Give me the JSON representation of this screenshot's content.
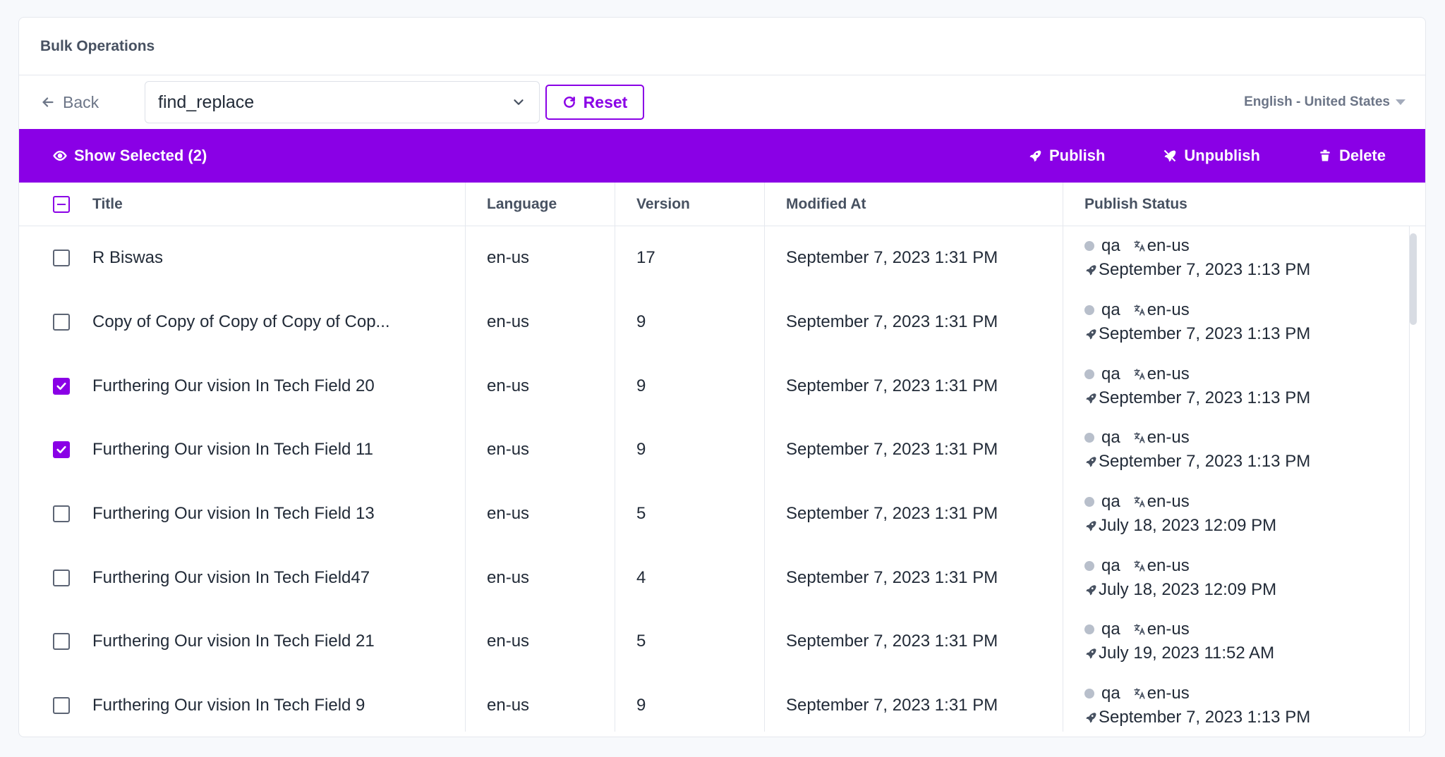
{
  "header": {
    "title": "Bulk Operations"
  },
  "toolbar": {
    "back_label": "Back",
    "select_value": "find_replace",
    "reset_label": "Reset",
    "locale_label": "English - United States"
  },
  "action_bar": {
    "show_selected_label": "Show Selected (2)",
    "publish_label": "Publish",
    "unpublish_label": "Unpublish",
    "delete_label": "Delete"
  },
  "table": {
    "columns": {
      "title": "Title",
      "language": "Language",
      "version": "Version",
      "modified_at": "Modified At",
      "publish_status": "Publish Status"
    },
    "rows": [
      {
        "title": "R Biswas",
        "language": "en-us",
        "version": "17",
        "modified": "September 7, 2023 1:31 PM",
        "env": "qa",
        "pub_lang": "en-us",
        "pub_date": "September 7, 2023 1:13 PM",
        "checked": false
      },
      {
        "title": "Copy of Copy of Copy of Copy of Cop...",
        "language": "en-us",
        "version": "9",
        "modified": "September 7, 2023 1:31 PM",
        "env": "qa",
        "pub_lang": "en-us",
        "pub_date": "September 7, 2023 1:13 PM",
        "checked": false
      },
      {
        "title": "Furthering Our vision In Tech Field 20",
        "language": "en-us",
        "version": "9",
        "modified": "September 7, 2023 1:31 PM",
        "env": "qa",
        "pub_lang": "en-us",
        "pub_date": "September 7, 2023 1:13 PM",
        "checked": true
      },
      {
        "title": "Furthering Our vision In Tech Field 11",
        "language": "en-us",
        "version": "9",
        "modified": "September 7, 2023 1:31 PM",
        "env": "qa",
        "pub_lang": "en-us",
        "pub_date": "September 7, 2023 1:13 PM",
        "checked": true
      },
      {
        "title": "Furthering Our vision In Tech Field 13",
        "language": "en-us",
        "version": "5",
        "modified": "September 7, 2023 1:31 PM",
        "env": "qa",
        "pub_lang": "en-us",
        "pub_date": "July 18, 2023 12:09 PM",
        "checked": false
      },
      {
        "title": "Furthering Our vision In Tech Field47",
        "language": "en-us",
        "version": "4",
        "modified": "September 7, 2023 1:31 PM",
        "env": "qa",
        "pub_lang": "en-us",
        "pub_date": "July 18, 2023 12:09 PM",
        "checked": false
      },
      {
        "title": "Furthering Our vision In Tech Field 21",
        "language": "en-us",
        "version": "5",
        "modified": "September 7, 2023 1:31 PM",
        "env": "qa",
        "pub_lang": "en-us",
        "pub_date": "July 19, 2023 11:52 AM",
        "checked": false
      },
      {
        "title": "Furthering Our vision In Tech Field 9",
        "language": "en-us",
        "version": "9",
        "modified": "September 7, 2023 1:31 PM",
        "env": "qa",
        "pub_lang": "en-us",
        "pub_date": "September 7, 2023 1:13 PM",
        "checked": false
      }
    ]
  },
  "colors": {
    "accent": "#8a00e6",
    "border": "#e5e8ee",
    "text": "#222b38",
    "muted": "#6c7587"
  }
}
